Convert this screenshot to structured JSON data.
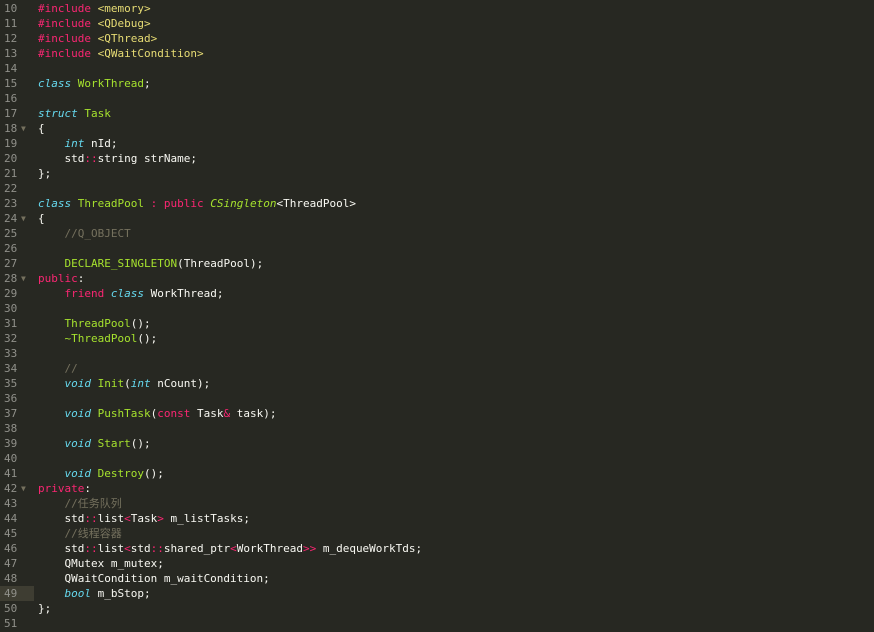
{
  "editor": {
    "theme_colors": {
      "background": "#272822",
      "foreground": "#f8f8f2",
      "keyword": "#f92672",
      "storage_type": "#66d9ef",
      "entity_name": "#a6e22e",
      "string": "#e6db74",
      "comment": "#75715e",
      "line_number": "#90908a"
    },
    "active_line": "49",
    "fold_icon": "fold-arrow-down-icon",
    "fold_glyph": "▼",
    "lines": [
      {
        "n": "10",
        "fold": false,
        "tokens": [
          {
            "t": "#include",
            "c": "kw"
          },
          {
            "t": " ",
            "c": "pl"
          },
          {
            "t": "<memory>",
            "c": "str"
          }
        ]
      },
      {
        "n": "11",
        "fold": false,
        "tokens": [
          {
            "t": "#include",
            "c": "kw"
          },
          {
            "t": " ",
            "c": "pl"
          },
          {
            "t": "<QDebug>",
            "c": "str"
          }
        ]
      },
      {
        "n": "12",
        "fold": false,
        "tokens": [
          {
            "t": "#include",
            "c": "kw"
          },
          {
            "t": " ",
            "c": "pl"
          },
          {
            "t": "<QThread>",
            "c": "str"
          }
        ]
      },
      {
        "n": "13",
        "fold": false,
        "tokens": [
          {
            "t": "#include",
            "c": "kw"
          },
          {
            "t": " ",
            "c": "pl"
          },
          {
            "t": "<QWaitCondition>",
            "c": "str"
          }
        ]
      },
      {
        "n": "14",
        "fold": false,
        "tokens": []
      },
      {
        "n": "15",
        "fold": false,
        "tokens": [
          {
            "t": "class",
            "c": "st"
          },
          {
            "t": " ",
            "c": "pl"
          },
          {
            "t": "WorkThread",
            "c": "ty"
          },
          {
            "t": ";",
            "c": "pl"
          }
        ]
      },
      {
        "n": "16",
        "fold": false,
        "tokens": []
      },
      {
        "n": "17",
        "fold": false,
        "tokens": [
          {
            "t": "struct",
            "c": "st"
          },
          {
            "t": " ",
            "c": "pl"
          },
          {
            "t": "Task",
            "c": "ty"
          }
        ]
      },
      {
        "n": "18",
        "fold": true,
        "tokens": [
          {
            "t": "{",
            "c": "pl"
          }
        ]
      },
      {
        "n": "19",
        "fold": false,
        "tokens": [
          {
            "t": "    ",
            "c": "pl"
          },
          {
            "t": "int",
            "c": "st"
          },
          {
            "t": " nId;",
            "c": "pl"
          }
        ]
      },
      {
        "n": "20",
        "fold": false,
        "tokens": [
          {
            "t": "    std",
            "c": "pl"
          },
          {
            "t": "::",
            "c": "kw"
          },
          {
            "t": "string strName;",
            "c": "pl"
          }
        ]
      },
      {
        "n": "21",
        "fold": false,
        "tokens": [
          {
            "t": "};",
            "c": "pl"
          }
        ]
      },
      {
        "n": "22",
        "fold": false,
        "tokens": []
      },
      {
        "n": "23",
        "fold": false,
        "tokens": [
          {
            "t": "class",
            "c": "st"
          },
          {
            "t": " ",
            "c": "pl"
          },
          {
            "t": "ThreadPool",
            "c": "ty"
          },
          {
            "t": " ",
            "c": "pl"
          },
          {
            "t": ":",
            "c": "kw"
          },
          {
            "t": " ",
            "c": "pl"
          },
          {
            "t": "public",
            "c": "kw"
          },
          {
            "t": " ",
            "c": "pl"
          },
          {
            "t": "CSingleton",
            "c": "tyi"
          },
          {
            "t": "<ThreadPool>",
            "c": "pl"
          }
        ]
      },
      {
        "n": "24",
        "fold": true,
        "tokens": [
          {
            "t": "{",
            "c": "pl"
          }
        ]
      },
      {
        "n": "25",
        "fold": false,
        "tokens": [
          {
            "t": "    ",
            "c": "pl"
          },
          {
            "t": "//Q_OBJECT",
            "c": "cm"
          }
        ]
      },
      {
        "n": "26",
        "fold": false,
        "tokens": []
      },
      {
        "n": "27",
        "fold": false,
        "tokens": [
          {
            "t": "    ",
            "c": "pl"
          },
          {
            "t": "DECLARE_SINGLETON",
            "c": "fn"
          },
          {
            "t": "(ThreadPool);",
            "c": "pl"
          }
        ]
      },
      {
        "n": "28",
        "fold": true,
        "tokens": [
          {
            "t": "public",
            "c": "kw"
          },
          {
            "t": ":",
            "c": "pl"
          }
        ]
      },
      {
        "n": "29",
        "fold": false,
        "tokens": [
          {
            "t": "    ",
            "c": "pl"
          },
          {
            "t": "friend",
            "c": "kw"
          },
          {
            "t": " ",
            "c": "pl"
          },
          {
            "t": "class",
            "c": "st"
          },
          {
            "t": " WorkThread;",
            "c": "pl"
          }
        ]
      },
      {
        "n": "30",
        "fold": false,
        "tokens": []
      },
      {
        "n": "31",
        "fold": false,
        "tokens": [
          {
            "t": "    ",
            "c": "pl"
          },
          {
            "t": "ThreadPool",
            "c": "fn"
          },
          {
            "t": "();",
            "c": "pl"
          }
        ]
      },
      {
        "n": "32",
        "fold": false,
        "tokens": [
          {
            "t": "    ",
            "c": "pl"
          },
          {
            "t": "~ThreadPool",
            "c": "fn"
          },
          {
            "t": "();",
            "c": "pl"
          }
        ]
      },
      {
        "n": "33",
        "fold": false,
        "tokens": []
      },
      {
        "n": "34",
        "fold": false,
        "tokens": [
          {
            "t": "    ",
            "c": "pl"
          },
          {
            "t": "//",
            "c": "cm"
          }
        ]
      },
      {
        "n": "35",
        "fold": false,
        "tokens": [
          {
            "t": "    ",
            "c": "pl"
          },
          {
            "t": "void",
            "c": "st"
          },
          {
            "t": " ",
            "c": "pl"
          },
          {
            "t": "Init",
            "c": "fn"
          },
          {
            "t": "(",
            "c": "pl"
          },
          {
            "t": "int",
            "c": "st"
          },
          {
            "t": " nCount);",
            "c": "pl"
          }
        ]
      },
      {
        "n": "36",
        "fold": false,
        "tokens": []
      },
      {
        "n": "37",
        "fold": false,
        "tokens": [
          {
            "t": "    ",
            "c": "pl"
          },
          {
            "t": "void",
            "c": "st"
          },
          {
            "t": " ",
            "c": "pl"
          },
          {
            "t": "PushTask",
            "c": "fn"
          },
          {
            "t": "(",
            "c": "pl"
          },
          {
            "t": "const",
            "c": "kw"
          },
          {
            "t": " Task",
            "c": "pl"
          },
          {
            "t": "&",
            "c": "kw"
          },
          {
            "t": " task);",
            "c": "pl"
          }
        ]
      },
      {
        "n": "38",
        "fold": false,
        "tokens": []
      },
      {
        "n": "39",
        "fold": false,
        "tokens": [
          {
            "t": "    ",
            "c": "pl"
          },
          {
            "t": "void",
            "c": "st"
          },
          {
            "t": " ",
            "c": "pl"
          },
          {
            "t": "Start",
            "c": "fn"
          },
          {
            "t": "();",
            "c": "pl"
          }
        ]
      },
      {
        "n": "40",
        "fold": false,
        "tokens": []
      },
      {
        "n": "41",
        "fold": false,
        "tokens": [
          {
            "t": "    ",
            "c": "pl"
          },
          {
            "t": "void",
            "c": "st"
          },
          {
            "t": " ",
            "c": "pl"
          },
          {
            "t": "Destroy",
            "c": "fn"
          },
          {
            "t": "();",
            "c": "pl"
          }
        ]
      },
      {
        "n": "42",
        "fold": true,
        "tokens": [
          {
            "t": "private",
            "c": "kw"
          },
          {
            "t": ":",
            "c": "pl"
          }
        ]
      },
      {
        "n": "43",
        "fold": false,
        "tokens": [
          {
            "t": "    ",
            "c": "pl"
          },
          {
            "t": "//任务队列",
            "c": "cm"
          }
        ]
      },
      {
        "n": "44",
        "fold": false,
        "tokens": [
          {
            "t": "    std",
            "c": "pl"
          },
          {
            "t": "::",
            "c": "kw"
          },
          {
            "t": "list",
            "c": "pl"
          },
          {
            "t": "<",
            "c": "kw"
          },
          {
            "t": "Task",
            "c": "pl"
          },
          {
            "t": ">",
            "c": "kw"
          },
          {
            "t": " m_listTasks;",
            "c": "pl"
          }
        ]
      },
      {
        "n": "45",
        "fold": false,
        "tokens": [
          {
            "t": "    ",
            "c": "pl"
          },
          {
            "t": "//线程容器",
            "c": "cm"
          }
        ]
      },
      {
        "n": "46",
        "fold": false,
        "tokens": [
          {
            "t": "    std",
            "c": "pl"
          },
          {
            "t": "::",
            "c": "kw"
          },
          {
            "t": "list",
            "c": "pl"
          },
          {
            "t": "<",
            "c": "kw"
          },
          {
            "t": "std",
            "c": "pl"
          },
          {
            "t": "::",
            "c": "kw"
          },
          {
            "t": "shared_ptr",
            "c": "pl"
          },
          {
            "t": "<",
            "c": "kw"
          },
          {
            "t": "WorkThread",
            "c": "pl"
          },
          {
            "t": ">>",
            "c": "kw"
          },
          {
            "t": " m_dequeWorkTds;",
            "c": "pl"
          }
        ]
      },
      {
        "n": "47",
        "fold": false,
        "tokens": [
          {
            "t": "    QMutex m_mutex;",
            "c": "pl"
          }
        ]
      },
      {
        "n": "48",
        "fold": false,
        "tokens": [
          {
            "t": "    QWaitCondition m_waitCondition;",
            "c": "pl"
          }
        ]
      },
      {
        "n": "49",
        "fold": false,
        "tokens": [
          {
            "t": "    ",
            "c": "pl"
          },
          {
            "t": "bool",
            "c": "st"
          },
          {
            "t": " m_bStop;",
            "c": "pl"
          }
        ]
      },
      {
        "n": "50",
        "fold": false,
        "tokens": [
          {
            "t": "};",
            "c": "pl"
          }
        ]
      },
      {
        "n": "51",
        "fold": false,
        "tokens": []
      }
    ]
  }
}
